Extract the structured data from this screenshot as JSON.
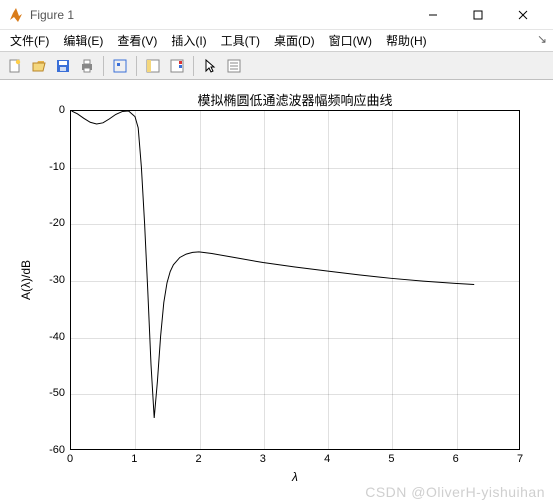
{
  "window": {
    "title": "Figure 1"
  },
  "menubar": {
    "items": [
      "文件(F)",
      "编辑(E)",
      "查看(V)",
      "插入(I)",
      "工具(T)",
      "桌面(D)",
      "窗口(W)",
      "帮助(H)"
    ]
  },
  "toolbar": {
    "icons": [
      "new",
      "open",
      "save",
      "print",
      "sep",
      "inspect",
      "sep",
      "link",
      "colorbar",
      "sep",
      "pointer",
      "props"
    ]
  },
  "chart_data": {
    "type": "line",
    "title": "模拟椭圆低通滤波器幅频响应曲线",
    "xlabel": "λ",
    "ylabel": "A(λ)/dB",
    "xlim": [
      0,
      7
    ],
    "ylim": [
      -60,
      0
    ],
    "xticks": [
      0,
      1,
      2,
      3,
      4,
      5,
      6,
      7
    ],
    "yticks": [
      -60,
      -50,
      -40,
      -30,
      -20,
      -10,
      0
    ],
    "grid": true,
    "series": [
      {
        "name": "response",
        "x": [
          0.01,
          0.1,
          0.2,
          0.3,
          0.4,
          0.5,
          0.6,
          0.7,
          0.8,
          0.9,
          1.0,
          1.05,
          1.1,
          1.15,
          1.2,
          1.25,
          1.3,
          1.35,
          1.4,
          1.45,
          1.5,
          1.55,
          1.6,
          1.7,
          1.8,
          1.9,
          2.0,
          2.2,
          2.5,
          3.0,
          3.5,
          4.0,
          4.5,
          5.0,
          5.5,
          6.0,
          6.3
        ],
        "y": [
          0.0,
          -0.5,
          -1.3,
          -2.0,
          -2.3,
          -2.1,
          -1.4,
          -0.6,
          -0.1,
          0.0,
          -1.0,
          -3.0,
          -10.0,
          -20.0,
          -32.0,
          -45.0,
          -54.5,
          -48.0,
          -40.0,
          -34.0,
          -30.5,
          -28.5,
          -27.3,
          -26.0,
          -25.4,
          -25.1,
          -25.0,
          -25.3,
          -25.9,
          -26.9,
          -27.7,
          -28.4,
          -29.1,
          -29.7,
          -30.2,
          -30.6,
          -30.8
        ]
      }
    ]
  },
  "watermark": "CSDN @OliverH-yishuihan"
}
